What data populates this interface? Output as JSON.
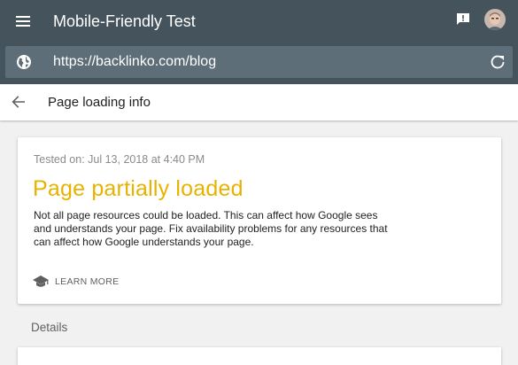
{
  "app": {
    "title": "Mobile-Friendly Test",
    "menu_icon": "hamburger-menu-icon",
    "feedback_icon": "feedback-icon",
    "avatar": "user-avatar",
    "colors": {
      "appbar": "#44535c",
      "urlbar": "#5d6e78",
      "status": "#e7b300"
    }
  },
  "urlbar": {
    "icon": "globe-icon",
    "value": "https://backlinko.com/blog",
    "refresh_icon": "refresh-icon"
  },
  "subheader": {
    "back_icon": "back-arrow-icon",
    "title": "Page loading info"
  },
  "result_card": {
    "tested_on": "Tested on: Jul 13, 2018 at 4:40 PM",
    "status": "Page partially loaded",
    "description": "Not all page resources could be loaded. This can affect how Google sees and understands your page. Fix availability problems for any resources that can affect how Google understands your page.",
    "learn_more_icon": "graduation-cap-icon",
    "learn_more_label": "LEARN MORE"
  },
  "details": {
    "label": "Details"
  }
}
